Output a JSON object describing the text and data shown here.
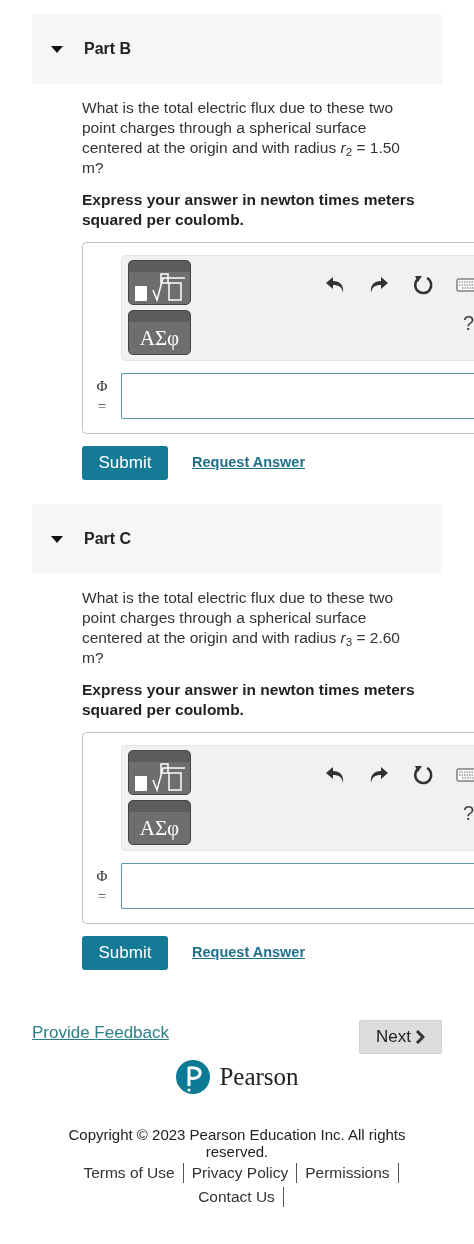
{
  "parts": [
    {
      "title": "Part B",
      "expanded": true,
      "question": "What is the total electric flux due to these two point charges through a spherical surface centered at the origin and with radius *r*$_{2}$ = 1.50 m?",
      "instruction": "Express your answer in newton times meters squared per coulomb.",
      "symbols_button": "ΑΣφ",
      "help_button": "?",
      "answer_label": "Φ =",
      "submit": "Submit",
      "request": "Request Answer"
    },
    {
      "title": "Part C",
      "expanded": true,
      "question": "What is the total electric flux due to these two point charges through a spherical surface centered at the origin and with radius *r*$_{3}$ = 2.60 m?",
      "instruction": "Express your answer in newton times meters squared per coulomb.",
      "symbols_button": "ΑΣφ",
      "help_button": "?",
      "answer_label": "Φ =",
      "submit": "Submit",
      "request": "Request Answer"
    }
  ],
  "footer": {
    "feedback": "Provide Feedback",
    "next": "Next",
    "brand": "Pearson",
    "copyright": "Copyright © 2023 Pearson Education Inc. All rights reserved.",
    "links": [
      "Terms of Use",
      "Privacy Policy",
      "Permissions",
      "Contact Us"
    ]
  }
}
